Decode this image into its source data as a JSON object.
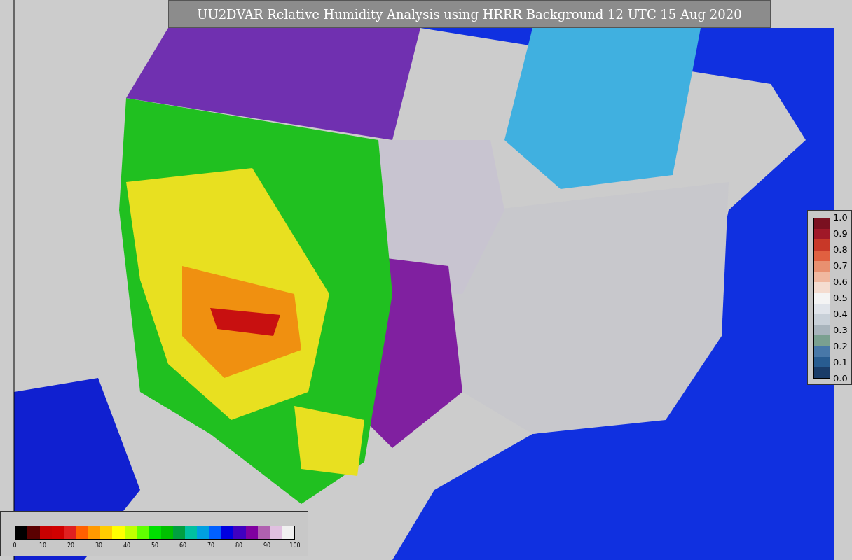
{
  "title": "UU2DVAR Relative Humidity Analysis using HRRR Background 12 UTC 15 Aug 2020",
  "humidity_legend": {
    "ticks": [
      "0",
      "10",
      "20",
      "30",
      "40",
      "50",
      "60",
      "70",
      "80",
      "90",
      "100"
    ]
  },
  "ratio_legend": {
    "ticks": [
      "1.0",
      "0.9",
      "0.8",
      "0.7",
      "0.6",
      "0.5",
      "0.4",
      "0.3",
      "0.2",
      "0.1",
      "0.0"
    ]
  }
}
